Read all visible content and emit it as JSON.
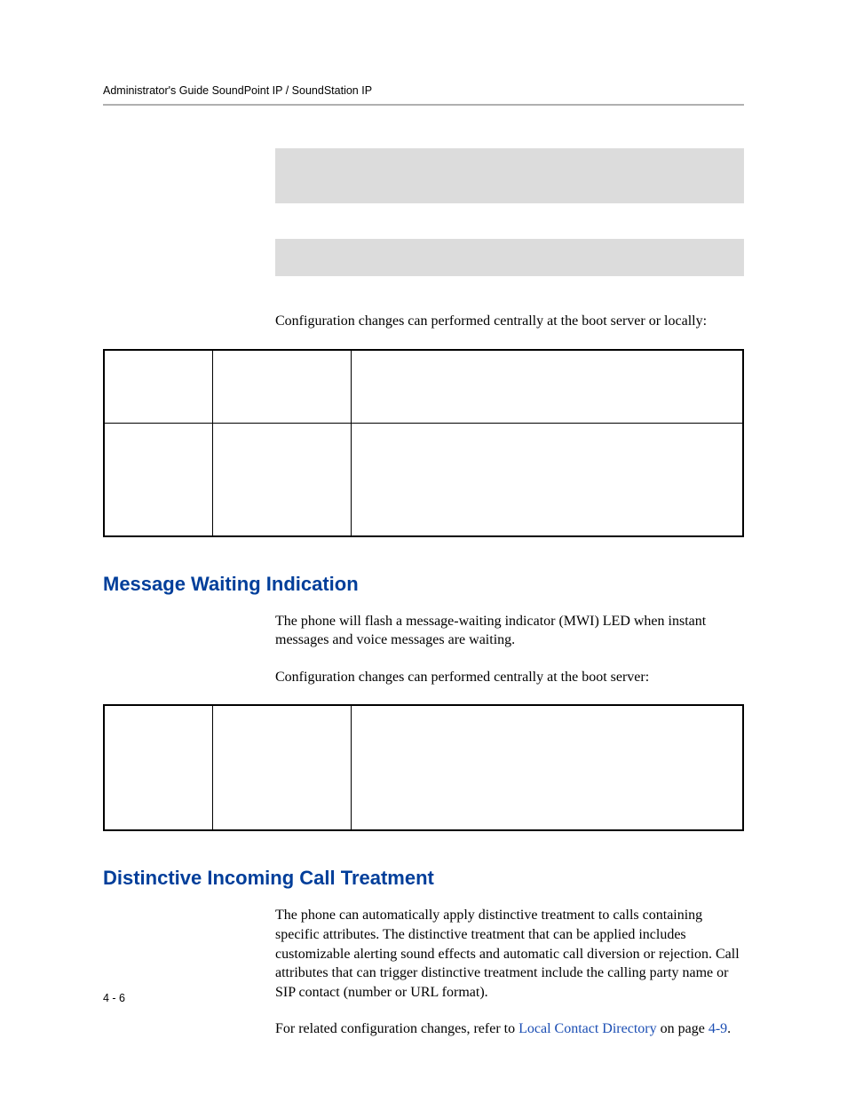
{
  "header": {
    "running_title": "Administrator's Guide SoundPoint IP / SoundStation IP"
  },
  "intro_line": "Configuration changes can performed centrally at the boot server or locally:",
  "section_mwi": {
    "heading": "Message Waiting Indication",
    "body1": "The phone will flash a message-waiting indicator (MWI) LED when instant messages and voice messages are waiting.",
    "body2": "Configuration changes can performed centrally at the boot server:"
  },
  "section_dict": {
    "heading": "Distinctive Incoming Call Treatment",
    "body1": "The phone can automatically apply distinctive treatment to calls containing specific attributes. The distinctive treatment that can be applied includes customizable alerting sound effects and automatic call diversion or rejection. Call attributes that can trigger distinctive treatment include the calling party name or SIP contact (number or URL format).",
    "body2_prefix": "For related configuration changes, refer to ",
    "body2_link": "Local Contact Directory",
    "body2_suffix": " on page ",
    "body2_pageref": "4-9",
    "body2_period": "."
  },
  "page_number": "4 - 6"
}
